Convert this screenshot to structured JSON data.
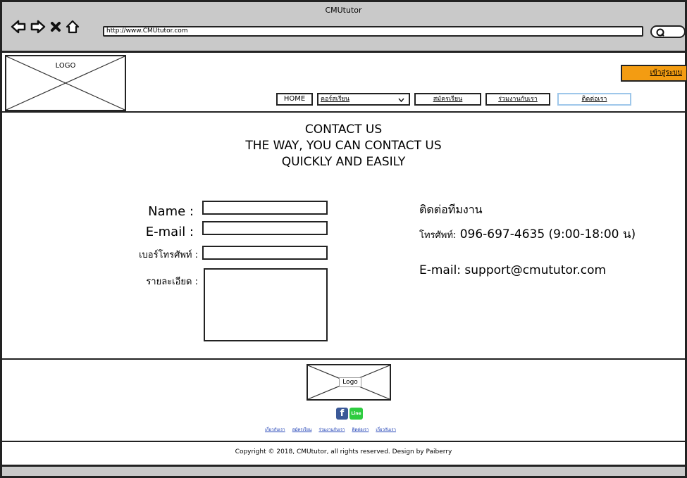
{
  "browser": {
    "title": "CMUtutor",
    "url": "http://www.CMUtutor.com"
  },
  "header": {
    "logo_label": "LOGO",
    "login_label": "เข้าสู่ระบบ",
    "nav": {
      "home": "HOME",
      "courses": "คอร์สเรียน",
      "register": "สมัครเรียน",
      "partner": "ร่วมงานกับเรา",
      "contact": "ติดต่อเรา"
    }
  },
  "hero": {
    "line1": "CONTACT US",
    "line2": "THE WAY, YOU CAN CONTACT US",
    "line3": "QUICKLY AND EASILY"
  },
  "form": {
    "name_label": "Name :",
    "email_label": "E-mail :",
    "phone_label": "เบอร์โทรศัพท์ :",
    "detail_label": "รายละเอียด :"
  },
  "contact": {
    "title": "ติดต่อทีมงาน",
    "phone_label": "โทรศัพท์:",
    "phone_value": "096-697-4635 (9:00-18:00 น)",
    "email": "E-mail: support@cmututor.com"
  },
  "footer": {
    "logo_label": "Logo",
    "facebook_label": "f",
    "line_label": "Line",
    "links": [
      "เกี่ยวกับเรา",
      "สมัครเรียน",
      "ร่วมงานกับเรา",
      "ติดต่อเรา",
      "เกี่ยวกับเรา"
    ],
    "copyright": "Copyright © 2018, CMUtutor, all rights reserved. Design by Paiberry"
  }
}
